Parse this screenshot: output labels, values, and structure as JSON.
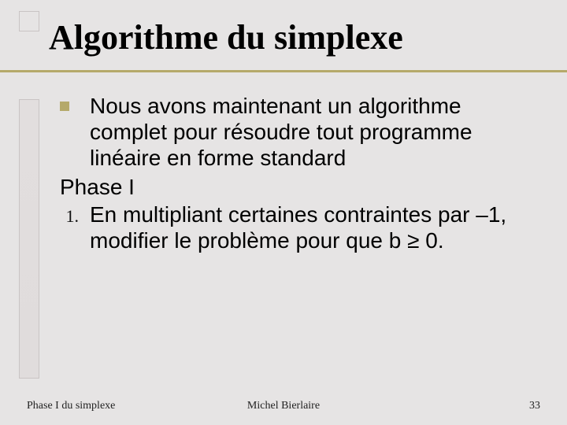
{
  "title": "Algorithme du simplexe",
  "bullet": {
    "text": "Nous avons maintenant un algorithme complet pour résoudre tout programme linéaire en forme standard"
  },
  "phase_label": "Phase I",
  "numbered": {
    "marker": "1.",
    "text": "En multipliant certaines contraintes par –1, modifier le problème pour que b ≥ 0."
  },
  "footer": {
    "left": "Phase I du simplexe",
    "center": "Michel Bierlaire",
    "right": "33"
  }
}
